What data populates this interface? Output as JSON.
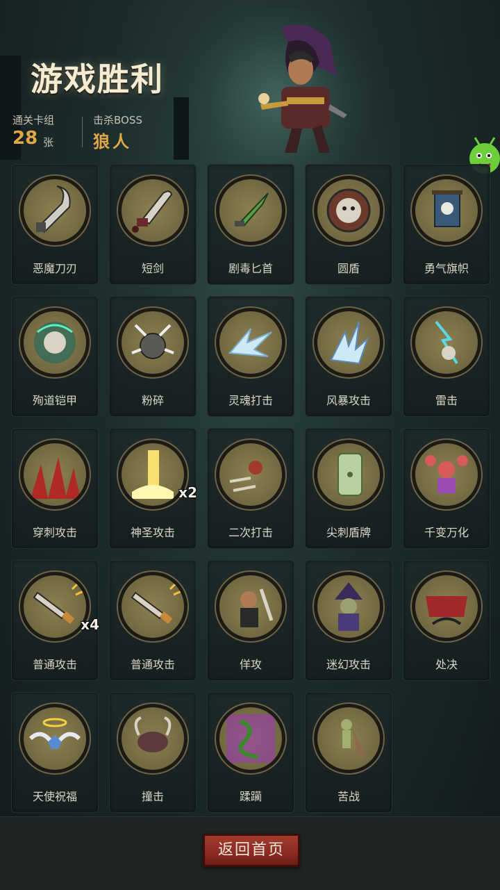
{
  "header": {
    "title": "游戏胜利",
    "deck_label": "通关卡组",
    "deck_count": "28",
    "deck_unit": "张",
    "boss_label": "击杀BOSS",
    "boss_name": "狼人"
  },
  "cards": [
    {
      "name": "恶魔刀刃",
      "icon": "demon-blade-icon",
      "badge": ""
    },
    {
      "name": "短剑",
      "icon": "short-sword-icon",
      "badge": ""
    },
    {
      "name": "剧毒匕首",
      "icon": "poison-dagger-icon",
      "badge": ""
    },
    {
      "name": "圆盾",
      "icon": "round-shield-icon",
      "badge": ""
    },
    {
      "name": "勇气旗帜",
      "icon": "courage-banner-icon",
      "badge": ""
    },
    {
      "name": "殉道铠甲",
      "icon": "martyr-armor-icon",
      "badge": ""
    },
    {
      "name": "粉碎",
      "icon": "smash-icon",
      "badge": ""
    },
    {
      "name": "灵魂打击",
      "icon": "soul-strike-icon",
      "badge": ""
    },
    {
      "name": "风暴攻击",
      "icon": "storm-attack-icon",
      "badge": ""
    },
    {
      "name": "雷击",
      "icon": "thunder-strike-icon",
      "badge": ""
    },
    {
      "name": "穿刺攻击",
      "icon": "pierce-attack-icon",
      "badge": ""
    },
    {
      "name": "神圣攻击",
      "icon": "holy-attack-icon",
      "badge": "x2"
    },
    {
      "name": "二次打击",
      "icon": "double-strike-icon",
      "badge": ""
    },
    {
      "name": "尖刺盾牌",
      "icon": "spiked-shield-icon",
      "badge": ""
    },
    {
      "name": "千变万化",
      "icon": "shapeshift-icon",
      "badge": ""
    },
    {
      "name": "普通攻击",
      "icon": "normal-attack-icon",
      "badge": "x4"
    },
    {
      "name": "普通攻击",
      "icon": "normal-attack-icon",
      "badge": ""
    },
    {
      "name": "佯攻",
      "icon": "feint-icon",
      "badge": ""
    },
    {
      "name": "迷幻攻击",
      "icon": "illusion-attack-icon",
      "badge": ""
    },
    {
      "name": "处决",
      "icon": "execute-icon",
      "badge": ""
    },
    {
      "name": "天使祝福",
      "icon": "angel-blessing-icon",
      "badge": ""
    },
    {
      "name": "撞击",
      "icon": "ram-icon",
      "badge": ""
    },
    {
      "name": "蹂躏",
      "icon": "ravage-icon",
      "badge": ""
    },
    {
      "name": "苦战",
      "icon": "hard-fight-icon",
      "badge": ""
    }
  ],
  "footer": {
    "return_label": "返回首页"
  },
  "colors": {
    "accent": "#e2a846",
    "button": "#a43a2e",
    "medallion": "#8c8050"
  }
}
